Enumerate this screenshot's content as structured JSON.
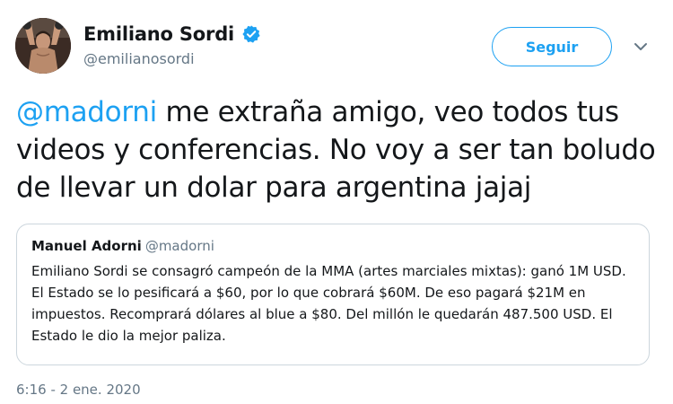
{
  "author": {
    "display_name": "Emiliano Sordi",
    "handle": "@emilianosordi",
    "verified": true,
    "verified_icon": "verified-badge-icon"
  },
  "follow_button": {
    "label": "Seguir"
  },
  "menu_icon": "chevron-down-icon",
  "tweet": {
    "mention": "@madorni",
    "text": " me extraña amigo, veo todos tus videos y conferencias. No voy a ser tan boludo de llevar un dolar para argentina jajaj"
  },
  "quoted_tweet": {
    "display_name": "Manuel Adorni",
    "handle": "@madorni",
    "text": "Emiliano Sordi se consagró campeón de la MMA (artes marciales mixtas): ganó 1M USD. El Estado se lo pesificará a $60, por lo que cobrará $60M. De eso pagará $21M en impuestos. Recomprará dólares al blue a $80. Del millón le quedarán 487.500 USD. El Estado le dio la mejor paliza."
  },
  "timestamp": "6:16 - 2 ene. 2020",
  "colors": {
    "accent": "#1da1f2",
    "text": "#14171a",
    "secondary": "#657786",
    "border": "#ccd6dd"
  }
}
